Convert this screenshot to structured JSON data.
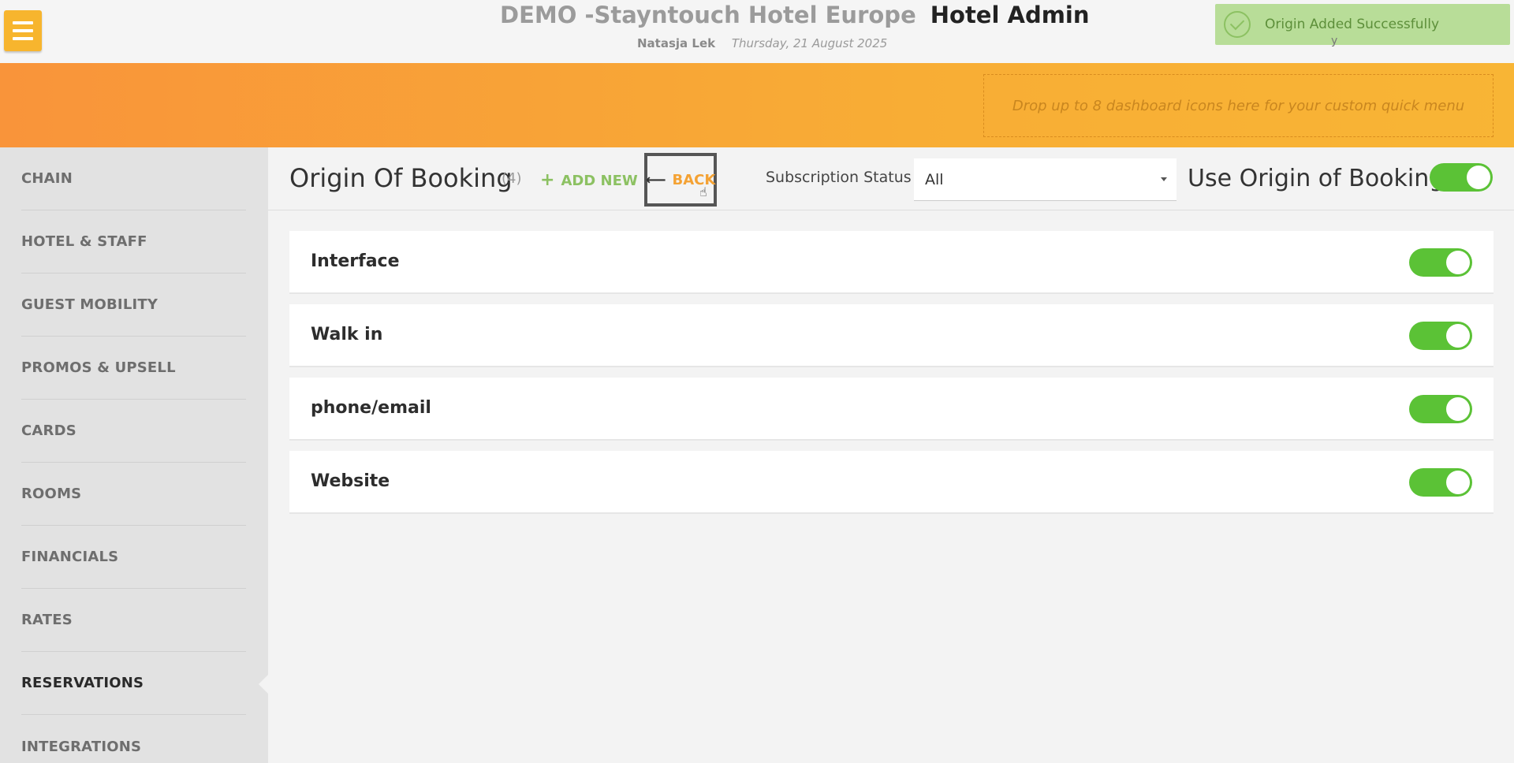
{
  "header": {
    "hotel_name": "DEMO -Stayntouch Hotel Europe",
    "app_title": "Hotel Admin",
    "user_name": "Natasja Lek",
    "date": "Thursday, 21 August 2025"
  },
  "toast": {
    "message": "Origin Added Successfully",
    "trailing_text": "y"
  },
  "quick_menu": {
    "placeholder": "Drop up to 8 dashboard icons here for your custom quick menu"
  },
  "sidebar": {
    "items": [
      {
        "label": "CHAIN"
      },
      {
        "label": "HOTEL & STAFF"
      },
      {
        "label": "GUEST MOBILITY"
      },
      {
        "label": "PROMOS & UPSELL"
      },
      {
        "label": "CARDS"
      },
      {
        "label": "ROOMS"
      },
      {
        "label": "FINANCIALS"
      },
      {
        "label": "RATES"
      },
      {
        "label": "RESERVATIONS",
        "active": true
      },
      {
        "label": "INTEGRATIONS"
      }
    ]
  },
  "toolbar": {
    "title": "Origin Of Booking",
    "count": "(4)",
    "add_new_label": "ADD NEW",
    "back_label": "BACK",
    "subscription_status_label": "Subscription Status",
    "subscription_status_value": "All",
    "use_origin_label": "Use Origin of Booking",
    "use_origin_enabled": true
  },
  "origins": [
    {
      "name": "Interface",
      "enabled": true
    },
    {
      "name": "Walk in",
      "enabled": true
    },
    {
      "name": "phone/email",
      "enabled": true
    },
    {
      "name": "Website",
      "enabled": true
    }
  ],
  "colors": {
    "accent_orange": "#f9943a",
    "toggle_green": "#5bc236",
    "add_new_green": "#8cc162",
    "back_orange": "#f4a234"
  },
  "icons": {
    "menu": "hamburger-icon",
    "toast": "check-circle-icon",
    "add": "plus-icon",
    "back": "arrow-left-icon",
    "cursor": "hand-pointer-icon",
    "select": "caret-down-icon"
  }
}
